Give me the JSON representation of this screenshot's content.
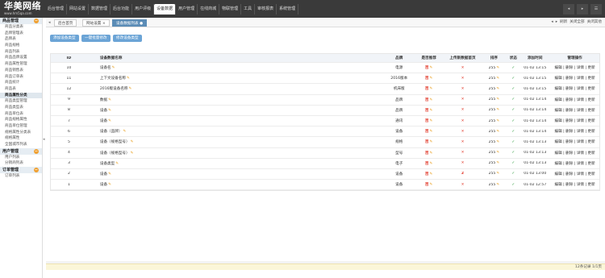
{
  "header": {
    "logo_title": "华美网络",
    "logo_subtitle": "www.hm5qa.com",
    "nav": [
      "后台管理",
      "网站设置",
      "数据管理",
      "后台功能",
      "用户评级",
      "设备数据",
      "用户管理",
      "在线商城",
      "物联管理",
      "工具",
      "审核报表",
      "系统管理"
    ],
    "active_nav": 5,
    "icons": [
      "◂",
      "▸",
      "☰"
    ]
  },
  "sidebar": {
    "sections": [
      {
        "label": "商品管理",
        "items": [
          "商品分类表",
          "品牌管理表",
          "品牌表",
          "商品规格",
          "商品列表",
          "商品品牌设置",
          "商品属性管理",
          "商品销售表",
          "商品订单表",
          "商品统计",
          "商品表"
        ]
      },
      {
        "label": "",
        "items": [
          "商品属性分类",
          "商品类型管理",
          "商品类型表",
          "商品单位表",
          "商品规格属性",
          "商品单位管理",
          "规格属性分类表",
          "规格属性",
          "全国城市列表"
        ],
        "active_first": true
      }
    ],
    "sec2": {
      "label": "用户管理",
      "items": [
        "用户列表",
        "分销商列表"
      ]
    },
    "sec3": {
      "label": "订单管理",
      "items": [
        "订单列表"
      ]
    }
  },
  "tabs": {
    "labels": [
      "后台首页",
      "网站设置",
      "设备数据列表"
    ],
    "controls": [
      "◂",
      "▸",
      "刷新",
      "关闭全部",
      "关闭其他"
    ]
  },
  "toolbar": {
    "buttons": [
      "添加设备类型",
      "一键批量修改",
      "修改设备类型"
    ]
  },
  "table": {
    "headers": [
      "ID",
      "设备数据名称",
      "品牌",
      "是否推荐",
      "上传新数据首页",
      "排序",
      "状态",
      "添加时间",
      "管理操作"
    ],
    "rows": [
      {
        "id": "10",
        "name": "设备名",
        "brand": "电源",
        "rec": "否",
        "new": "否",
        "sort": "255",
        "time": "01-02 13:15",
        "ops": "编辑 | 删除 | 详情 | 更新"
      },
      {
        "id": "11",
        "name": "上下文设备名称",
        "brand": "2016版本",
        "rec": "否",
        "new": "否",
        "sort": "255",
        "time": "01-02 13:15",
        "ops": "编辑 | 删除 | 详情 | 更新"
      },
      {
        "id": "12",
        "name": "2016版设备名称",
        "brand": "机床版",
        "rec": "否",
        "new": "否",
        "sort": "255",
        "time": "01-02 13:15",
        "ops": "编辑 | 删除 | 详情 | 更新"
      },
      {
        "id": "9",
        "name": "数据",
        "brand": "品牌",
        "rec": "否",
        "new": "否",
        "sort": "255",
        "time": "01-02 13:14",
        "ops": "编辑 | 删除 | 详情 | 更新"
      },
      {
        "id": "8",
        "name": "设备",
        "brand": "品牌",
        "rec": "否",
        "new": "否",
        "sort": "255",
        "time": "01-02 13:14",
        "ops": "编辑 | 删除 | 详情 | 更新"
      },
      {
        "id": "7",
        "name": "设备",
        "brand": "通讯",
        "rec": "否",
        "new": "否",
        "sort": "255",
        "time": "01-02 13:14",
        "ops": "编辑 | 删除 | 详情 | 更新"
      },
      {
        "id": "6",
        "name": "设备（品牌）",
        "brand": "设备",
        "rec": "否",
        "new": "否",
        "sort": "255",
        "time": "01-02 13:14",
        "ops": "编辑 | 删除 | 详情 | 更新"
      },
      {
        "id": "5",
        "name": "设备（规格型号）",
        "brand": "规格",
        "rec": "否",
        "new": "否",
        "sort": "255",
        "time": "01-02 13:13",
        "ops": "编辑 | 删除 | 详情 | 更新"
      },
      {
        "id": "4",
        "name": "设备（规格型号）",
        "brand": "型号",
        "rec": "否",
        "new": "否",
        "sort": "255",
        "time": "01-02 13:13",
        "ops": "编辑 | 删除 | 详情 | 更新"
      },
      {
        "id": "3",
        "name": "设备类型",
        "brand": "电子",
        "rec": "否",
        "new": "否",
        "sort": "255",
        "time": "01-02 13:13",
        "ops": "编辑 | 删除 | 详情 | 更新"
      },
      {
        "id": "2",
        "name": "设备",
        "brand": "设备",
        "rec": "否",
        "new": "否",
        "sort": "255",
        "time": "01-02 13:00",
        "ops": "编辑 | 删除 | 详情 | 更新"
      },
      {
        "id": "1",
        "name": "设备",
        "brand": "设备",
        "rec": "否",
        "new": "否",
        "sort": "255",
        "time": "01-02 12:57",
        "ops": "编辑 | 删除 | 详情 | 更新"
      }
    ],
    "row_new_flags": [
      false,
      false,
      false,
      false,
      false,
      false,
      false,
      false,
      false,
      false,
      true,
      false
    ]
  },
  "footer": {
    "text": "12条记录 1/1页"
  }
}
